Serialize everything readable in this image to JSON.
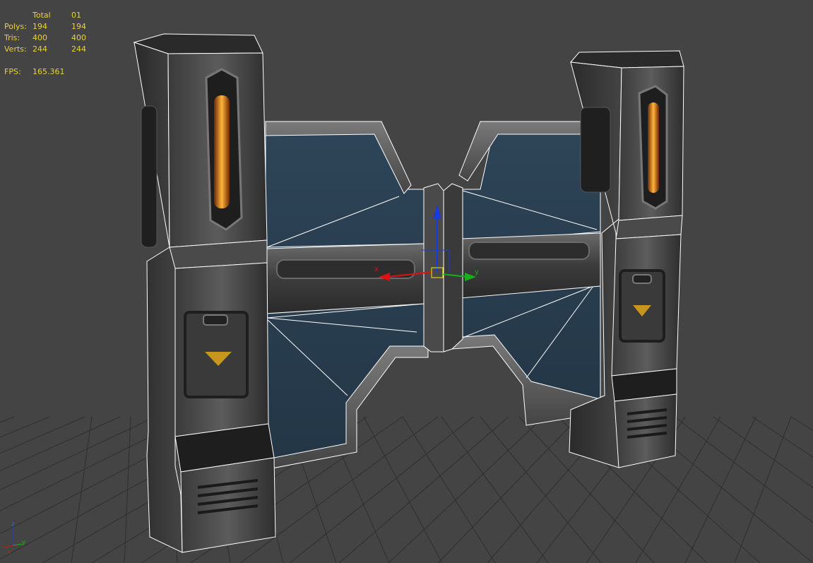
{
  "stats": {
    "header": {
      "label": "",
      "total": "Total",
      "object": "01"
    },
    "polys": {
      "label": "Polys:",
      "total": "194",
      "object": "194"
    },
    "tris": {
      "label": "Tris:",
      "total": "400",
      "object": "400"
    },
    "verts": {
      "label": "Verts:",
      "total": "244",
      "object": "244"
    },
    "fps": {
      "label": "FPS:",
      "value": "165.361"
    }
  },
  "gizmo": {
    "axis_x_label": "x",
    "axis_y_label": "y"
  },
  "view_axis": {
    "z_label": "z",
    "x_label": "x",
    "y_label": "y"
  },
  "colors": {
    "viewport_bg": "#444444",
    "grid_line": "#2a2a2a",
    "stats_text": "#e8d23a",
    "panel_blue": "#2b4053",
    "metal_dark": "#2e2e2e",
    "metal_mid": "#5a5a5a",
    "wire_edge": "#ffffff",
    "light_orange": "#e07a14",
    "indicator_arrow": "#c8961e",
    "axis_x": "#e01010",
    "axis_y": "#18b018",
    "axis_z": "#1a3ae0"
  }
}
